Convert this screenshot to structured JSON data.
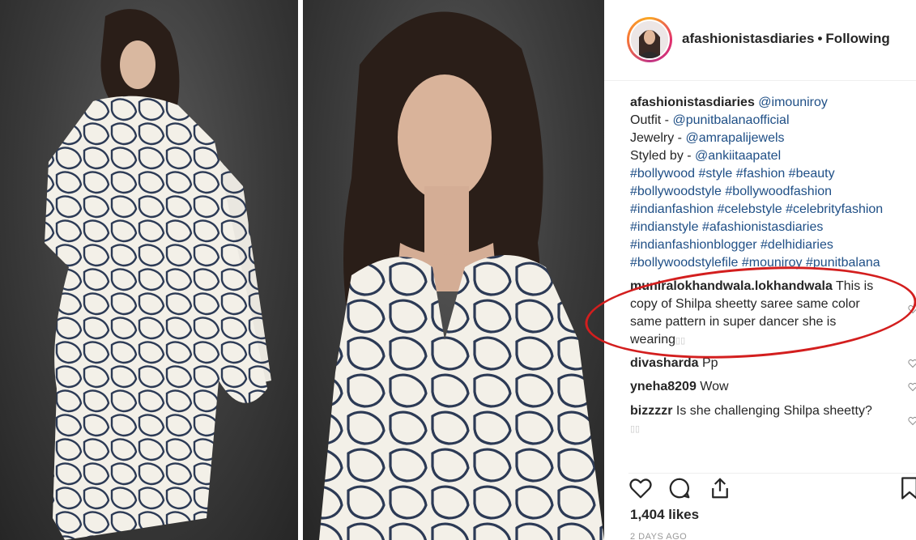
{
  "header": {
    "username": "afashionistasdiaries",
    "separator": "•",
    "follow_status": "Following"
  },
  "caption": {
    "username": "afashionistasdiaries",
    "lines": [
      {
        "prefix": "",
        "mention": "@imouniroy"
      },
      {
        "prefix": "Outfit - ",
        "mention": "@punitbalanaofficial"
      },
      {
        "prefix": "Jewelry - ",
        "mention": "@amrapalijewels"
      },
      {
        "prefix": "Styled by - ",
        "mention": "@ankiitaapatel"
      }
    ],
    "hashtags": [
      "#bollywood #style #fashion #beauty",
      "#bollywoodstyle #bollywoodfashion",
      "#indianfashion #celebstyle #celebrityfashion",
      "#indianstyle #afashionistasdiaries",
      "#indianfashionblogger #delhidiaries",
      "#bollywoodstylefile #mouniroy #punitbalana"
    ]
  },
  "comments": [
    {
      "username": "muniralokhandwala.lokhandwala",
      "text_line1": "This is",
      "text_line2": "copy of Shilpa sheetty saree same color",
      "text_line3": "same pattern in super dancer she is",
      "text_line4": "wearing",
      "tail_mark": "▯▯"
    },
    {
      "username": "divasharda",
      "text": "Pp"
    },
    {
      "username": "yneha8209",
      "text": "Wow"
    },
    {
      "username": "bizzzzr",
      "text": "Is she challenging Shilpa sheetty?",
      "tail_mark": "▯▯"
    }
  ],
  "icons": {
    "like": "heart-icon",
    "comment": "comment-icon",
    "share": "share-icon",
    "save": "bookmark-icon"
  },
  "likes_label": "1,404 likes",
  "time_ago": "2 DAYS AGO",
  "colors": {
    "link": "#1f4f86",
    "annotation": "#d31e1e",
    "text": "#262626"
  }
}
